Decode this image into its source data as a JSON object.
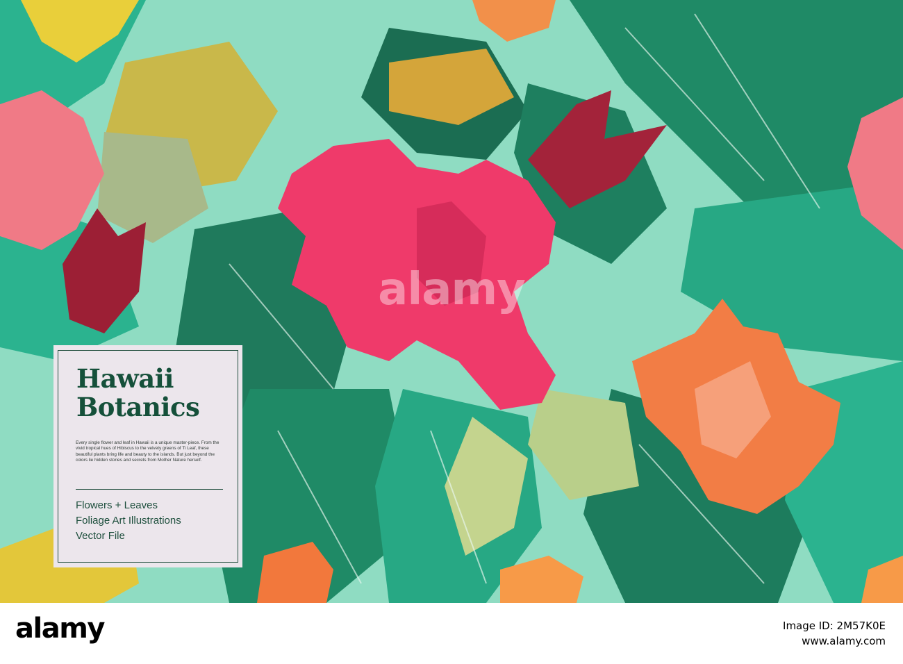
{
  "card": {
    "title_line1": "Hawaii",
    "title_line2": "Botanics",
    "description": "Every single flower and leaf in Hawaii is a unique master-piece. From the vivid tropical hues of Hibiscus to the velvety greens of Ti Leaf, these beautiful plants bring life and beauty to the islands. But just beyond the colors lie hidden stories and secrets from Mother Nature herself.",
    "features": [
      "Flowers + Leaves",
      "Foliage Art Illustrations",
      "Vector File"
    ]
  },
  "watermark": "alamy",
  "footer": {
    "logo": "alamy",
    "image_id_label": "Image ID: 2M57K0E",
    "site": "www.alamy.com"
  },
  "colors": {
    "background_mint": "#8fdcc2",
    "leaf_dark_green": "#1f7a5c",
    "leaf_teal": "#2bb38f",
    "hibiscus_pink": "#ef3a6a",
    "orange": "#f2783c",
    "yellow": "#e9cf3a",
    "card_bg": "#ece6ec",
    "card_text": "#15503a"
  }
}
